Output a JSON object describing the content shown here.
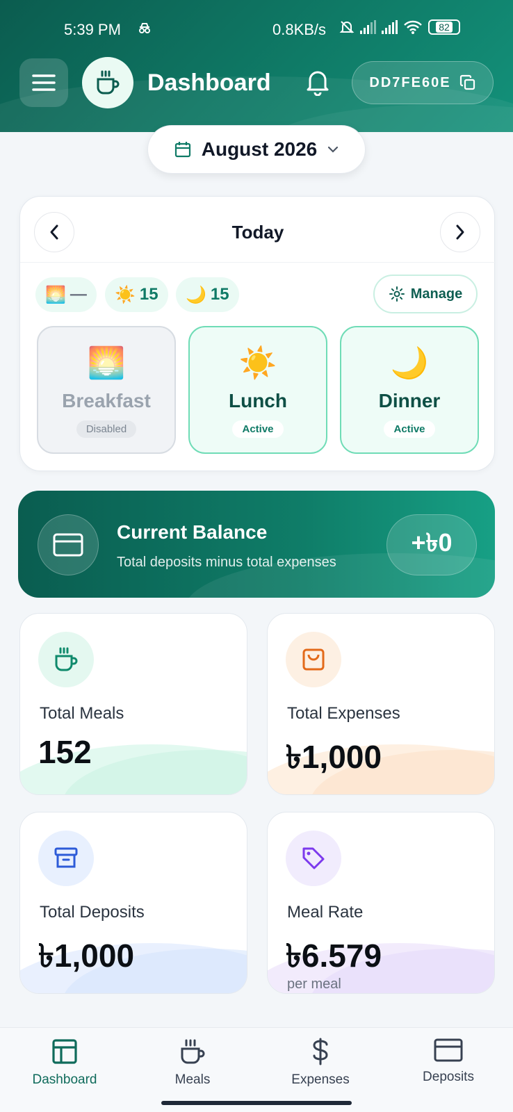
{
  "status_bar": {
    "time": "5:39 PM",
    "net_speed": "0.8KB/s",
    "battery": "82"
  },
  "header": {
    "title": "Dashboard",
    "code": "DD7FE60E"
  },
  "month_selector": {
    "label": "August 2026"
  },
  "today": {
    "label": "Today",
    "chips": [
      {
        "emoji": "🌅",
        "value": "—"
      },
      {
        "emoji": "☀️",
        "value": "15"
      },
      {
        "emoji": "🌙",
        "value": "15"
      }
    ],
    "manage_label": "Manage",
    "meals": [
      {
        "emoji": "🌅",
        "name": "Breakfast",
        "status": "Disabled"
      },
      {
        "emoji": "☀️",
        "name": "Lunch",
        "status": "Active"
      },
      {
        "emoji": "🌙",
        "name": "Dinner",
        "status": "Active"
      }
    ]
  },
  "balance": {
    "title": "Current Balance",
    "subtitle": "Total deposits minus total expenses",
    "value": "+৳0"
  },
  "stats": [
    {
      "label": "Total Meals",
      "value": "152",
      "sub": ""
    },
    {
      "label": "Total Expenses",
      "value": "৳1,000",
      "sub": ""
    },
    {
      "label": "Total Deposits",
      "value": "৳1,000",
      "sub": ""
    },
    {
      "label": "Meal Rate",
      "value": "৳6.579",
      "sub": "per meal"
    }
  ],
  "colors": {
    "primary": "#0f7a66",
    "primary_dark": "#0b5c4f",
    "accent_mint": "#6fdcb6"
  },
  "bottom_nav": [
    {
      "label": "Dashboard",
      "icon": "dashboard-icon"
    },
    {
      "label": "Meals",
      "icon": "coffee-cup-icon"
    },
    {
      "label": "Expenses",
      "icon": "dollar-icon"
    },
    {
      "label": "Deposits",
      "icon": "card-icon"
    }
  ]
}
